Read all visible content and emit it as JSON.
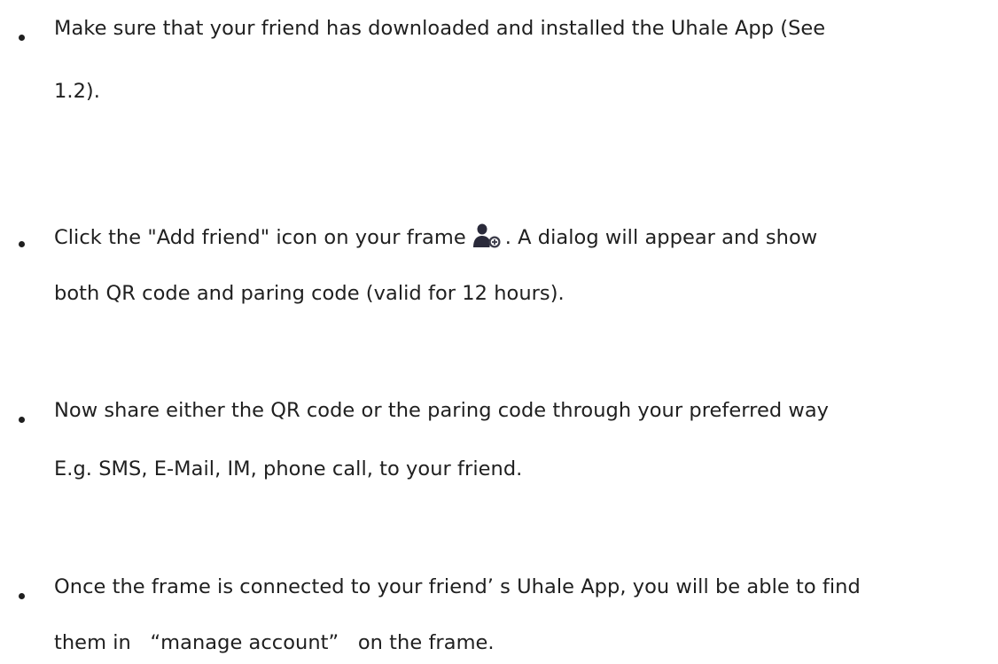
{
  "bullets": [
    {
      "lines": [
        "Make sure that your friend has downloaded and installed the Uhale App (See",
        "1.2)."
      ]
    },
    {
      "line1_before_icon": "Click the \"Add friend\" icon on your frame",
      "line1_after_icon": ". A dialog will appear and show",
      "icon": "add-friend-icon",
      "lines": [
        "both QR code and paring code (valid for 12 hours)."
      ]
    },
    {
      "lines": [
        "Now share either the QR code or the paring code through your preferred way",
        "E.g. SMS, E-Mail, IM, phone call, to your friend."
      ]
    },
    {
      "lines": [
        "Once the frame is connected to your friend’ s Uhale App, you will be able to find",
        "them in   “manage account”   on the frame."
      ]
    }
  ],
  "colors": {
    "text": "#1f1f1f",
    "icon_figure": "#2a2a3a",
    "icon_plus_circle": "#3a3a48"
  }
}
